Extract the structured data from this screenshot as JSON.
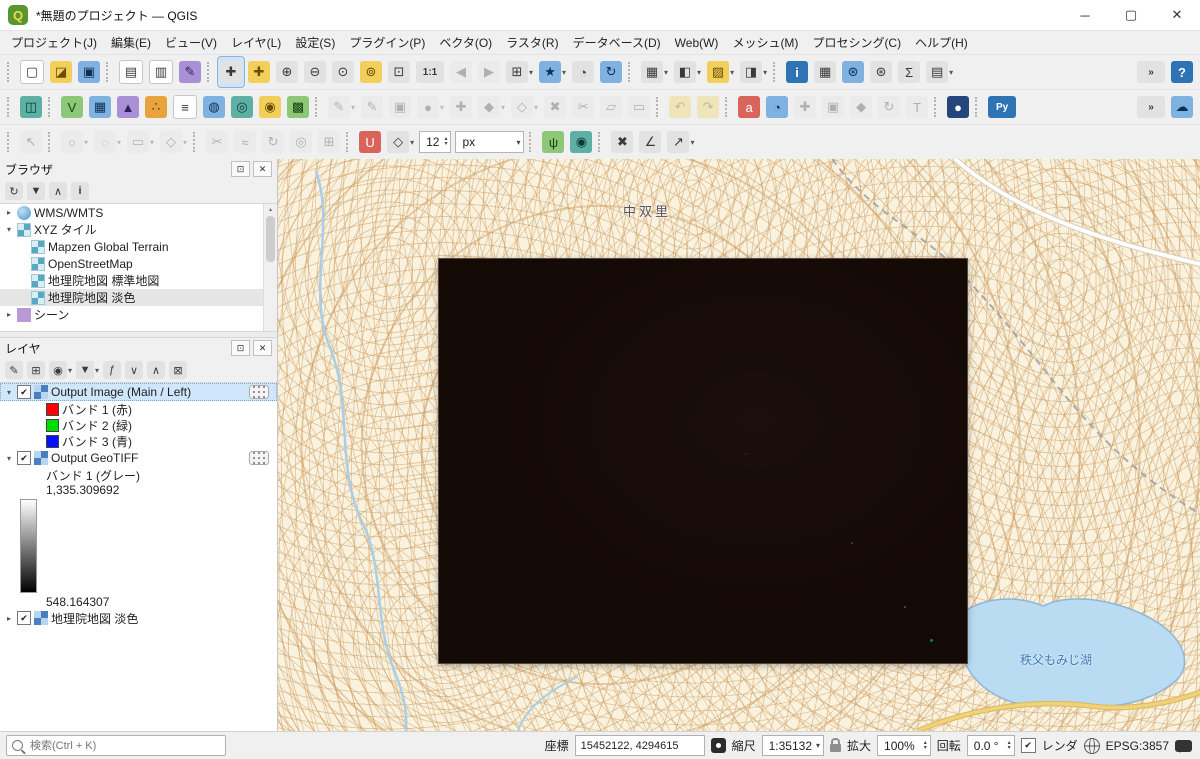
{
  "ui": {
    "dropdown": "▾",
    "overflow": "»",
    "arrow_right": "▸",
    "arrow_down": "▾",
    "check": "✔",
    "float": "⊡",
    "close": "✕",
    "spin_up": "▴",
    "spin_down": "▾",
    "logo": "Q",
    "help": "?"
  },
  "window": {
    "title": "*無題のプロジェクト — QGIS",
    "controls": {
      "minimize": "─",
      "maximize": "▢",
      "close": "✕"
    }
  },
  "menus": [
    {
      "id": "project",
      "label": "プロジェクト(J)"
    },
    {
      "id": "edit",
      "label": "編集(E)"
    },
    {
      "id": "view",
      "label": "ビュー(V)"
    },
    {
      "id": "layer",
      "label": "レイヤ(L)"
    },
    {
      "id": "settings",
      "label": "設定(S)"
    },
    {
      "id": "plugins",
      "label": "プラグイン(P)"
    },
    {
      "id": "vector",
      "label": "ベクタ(O)"
    },
    {
      "id": "raster",
      "label": "ラスタ(R)"
    },
    {
      "id": "database",
      "label": "データベース(D)"
    },
    {
      "id": "web",
      "label": "Web(W)"
    },
    {
      "id": "mesh",
      "label": "メッシュ(M)"
    },
    {
      "id": "processing",
      "label": "プロセシング(C)"
    },
    {
      "id": "help",
      "label": "ヘルプ(H)"
    }
  ],
  "toolbar_rows": [
    {
      "name": "toolbar-row-1",
      "groups": [
        [
          {
            "name": "new-project",
            "glyph": "▢",
            "tint": "white"
          },
          {
            "name": "open-project",
            "glyph": "◪",
            "tint": "yellow"
          },
          {
            "name": "save-project",
            "glyph": "▣",
            "tint": "blue"
          }
        ],
        [
          {
            "name": "new-print-layout",
            "glyph": "▤",
            "tint": "white"
          },
          {
            "name": "layout-manager",
            "glyph": "▥",
            "tint": "white"
          },
          {
            "name": "style-manager",
            "glyph": "✎",
            "tint": "purple"
          }
        ],
        [
          {
            "name": "pan-map",
            "glyph": "✚",
            "active": true
          },
          {
            "name": "pan-to-selection",
            "glyph": "✚",
            "tint": "yellow"
          },
          {
            "name": "zoom-in",
            "glyph": "⊕"
          },
          {
            "name": "zoom-out",
            "glyph": "⊖"
          },
          {
            "name": "zoom-full",
            "glyph": "⊙"
          },
          {
            "name": "zoom-to-selection",
            "glyph": "⊚",
            "tint": "yellow"
          },
          {
            "name": "zoom-to-layer",
            "glyph": "⊡"
          },
          {
            "name": "zoom-native",
            "glyph": "1:1",
            "wide": true
          },
          {
            "name": "zoom-last",
            "glyph": "◀",
            "disabled": true
          },
          {
            "name": "zoom-next",
            "glyph": "▶",
            "disabled": true
          },
          {
            "name": "new-map-view",
            "glyph": "⊞",
            "dropdown": true
          },
          {
            "name": "show-spatial-bookmarks",
            "glyph": "★",
            "tint": "blue",
            "dropdown": true
          },
          {
            "name": "temporal-controller",
            "glyph": "◔"
          },
          {
            "name": "refresh-map",
            "glyph": "↻",
            "tint": "blue"
          }
        ],
        [
          {
            "name": "new-3d-map-view",
            "glyph": "▦",
            "dropdown": true
          },
          {
            "name": "map-decorations",
            "glyph": "◧",
            "dropdown": true
          },
          {
            "name": "copy-layer-style",
            "glyph": "▨",
            "tint": "yellow",
            "dropdown": true
          },
          {
            "name": "project-styles",
            "glyph": "◨",
            "dropdown": true
          }
        ],
        [
          {
            "name": "identify-features",
            "glyph": "i",
            "tint": "blue-solid"
          },
          {
            "name": "open-attribute-table",
            "glyph": "▦"
          },
          {
            "name": "options",
            "glyph": "⊛",
            "tint": "blue"
          },
          {
            "name": "processing-toolbox",
            "glyph": "⊛"
          },
          {
            "name": "statistical-summary",
            "glyph": "Σ"
          },
          {
            "name": "manage-panels",
            "glyph": "▤",
            "dropdown": true
          }
        ]
      ],
      "right": [
        {
          "name": "toolbar-overflow-1",
          "glyph": "»",
          "wide": true
        },
        {
          "name": "help-contents",
          "glyph": "?",
          "tint": "blue-solid"
        }
      ]
    },
    {
      "name": "toolbar-row-2",
      "groups": [
        [
          {
            "name": "data-source-manager",
            "glyph": "◫",
            "tint": "teal"
          }
        ],
        [
          {
            "name": "add-vector-layer",
            "glyph": "V",
            "tint": "green"
          },
          {
            "name": "add-raster-layer",
            "glyph": "▦",
            "tint": "blue"
          },
          {
            "name": "add-mesh-layer",
            "glyph": "▲",
            "tint": "purple"
          },
          {
            "name": "add-point-cloud-layer",
            "glyph": "∴",
            "tint": "orange"
          },
          {
            "name": "add-delimited-text-layer",
            "glyph": "≡",
            "tint": "white"
          },
          {
            "name": "add-postgis-layer",
            "glyph": "◍",
            "tint": "blue"
          },
          {
            "name": "add-spatialite-layer",
            "glyph": "◎",
            "tint": "teal"
          },
          {
            "name": "add-wms-layer",
            "glyph": "◉",
            "tint": "yellow"
          },
          {
            "name": "add-xyz-layer",
            "glyph": "▩",
            "tint": "green"
          }
        ],
        [
          {
            "name": "current-edits",
            "glyph": "✎",
            "disabled": true,
            "dropdown": true
          },
          {
            "name": "toggle-editing",
            "glyph": "✎",
            "disabled": true
          },
          {
            "name": "save-layer-edits",
            "glyph": "▣",
            "disabled": true
          },
          {
            "name": "digitize-with-segment",
            "glyph": "●",
            "disabled": true,
            "dropdown": true
          },
          {
            "name": "add-feature",
            "glyph": "✚",
            "disabled": true
          },
          {
            "name": "move-feature",
            "glyph": "◆",
            "disabled": true,
            "dropdown": true
          },
          {
            "name": "vertex-tool",
            "glyph": "◇",
            "disabled": true,
            "dropdown": true
          },
          {
            "name": "delete-selected",
            "glyph": "✖",
            "disabled": true
          },
          {
            "name": "cut-features",
            "glyph": "✂",
            "disabled": true
          },
          {
            "name": "copy-features",
            "glyph": "▱",
            "disabled": true
          },
          {
            "name": "paste-features",
            "glyph": "▭",
            "disabled": true
          }
        ],
        [
          {
            "name": "undo",
            "glyph": "↶",
            "tint": "yellow",
            "disabled": true
          },
          {
            "name": "redo",
            "glyph": "↷",
            "tint": "yellow",
            "disabled": true
          }
        ],
        [
          {
            "name": "layer-labeling",
            "glyph": "a",
            "tint": "red"
          },
          {
            "name": "layer-diagrams",
            "glyph": "◔",
            "tint": "blue"
          },
          {
            "name": "pin-unpin-labels",
            "glyph": "✚",
            "disabled": true
          },
          {
            "name": "highlight-pinned-labels",
            "glyph": "▣",
            "disabled": true
          },
          {
            "name": "move-label",
            "glyph": "◆",
            "disabled": true
          },
          {
            "name": "rotate-label",
            "glyph": "↻",
            "disabled": true
          },
          {
            "name": "change-label",
            "glyph": "T",
            "disabled": true
          }
        ],
        [
          {
            "name": "metasearch",
            "glyph": "●",
            "tint": "dark-blue"
          }
        ],
        [
          {
            "name": "python-console",
            "glyph": "Py",
            "tint": "blue-solid",
            "wide": true
          }
        ]
      ],
      "right": [
        {
          "name": "toolbar-overflow-2",
          "glyph": "»",
          "wide": true
        },
        {
          "name": "cloud-projects",
          "glyph": "☁",
          "tint": "blue"
        }
      ]
    },
    {
      "name": "toolbar-row-3",
      "groups": [
        [
          {
            "name": "select-features-tool",
            "glyph": "↖",
            "disabled": true
          }
        ],
        [
          {
            "name": "digitize-circle",
            "glyph": "○",
            "disabled": true,
            "dropdown": true
          },
          {
            "name": "digitize-ellipse",
            "glyph": "◌",
            "disabled": true,
            "dropdown": true
          },
          {
            "name": "digitize-rectangle",
            "glyph": "▭",
            "disabled": true,
            "dropdown": true
          },
          {
            "name": "digitize-regular-polygon",
            "glyph": "◇",
            "disabled": true,
            "dropdown": true
          }
        ],
        [
          {
            "name": "split-features",
            "glyph": "✂",
            "disabled": true
          },
          {
            "name": "reshape-features",
            "glyph": "≈",
            "disabled": true
          },
          {
            "name": "rotate-feature",
            "glyph": "↻",
            "disabled": true
          },
          {
            "name": "offset-curve",
            "glyph": "◎",
            "disabled": true
          },
          {
            "name": "merge-features",
            "glyph": "⊞",
            "disabled": true
          }
        ],
        [
          {
            "name": "enable-snapping",
            "glyph": "U",
            "tint": "red"
          },
          {
            "name": "snapping-mode",
            "glyph": "◇",
            "dropdown": true
          },
          {
            "name": "snapping-tolerance",
            "type": "spin",
            "value": "12"
          },
          {
            "name": "snapping-unit",
            "type": "select",
            "value": "px"
          }
        ],
        [
          {
            "name": "enable-tracing",
            "glyph": "ψ",
            "tint": "green"
          },
          {
            "name": "advanced-digitizing",
            "glyph": "◉",
            "tint": "teal"
          }
        ],
        [
          {
            "name": "clear-canvas",
            "glyph": "✖"
          },
          {
            "name": "azimuth-tool",
            "glyph": "∠"
          },
          {
            "name": "pointer-tool",
            "glyph": "↗",
            "dropdown": true
          }
        ]
      ],
      "right": []
    }
  ],
  "browser": {
    "title": "ブラウザ",
    "toolbar": [
      {
        "name": "browser-refresh",
        "glyph": "↻"
      },
      {
        "name": "browser-filter",
        "glyph": "▼",
        "tint": "yellow"
      },
      {
        "name": "browser-collapse-all",
        "glyph": "∧"
      },
      {
        "name": "browser-properties",
        "glyph": "i",
        "tint": "blue-solid"
      }
    ],
    "items": [
      {
        "label": "WMS/WMTS",
        "depth": 0,
        "arrow": "right",
        "icon": "wms"
      },
      {
        "label": "XYZ タイル",
        "depth": 0,
        "arrow": "down",
        "icon": "grid"
      },
      {
        "label": "Mapzen Global Terrain",
        "depth": 1,
        "icon": "grid"
      },
      {
        "label": "OpenStreetMap",
        "depth": 1,
        "icon": "grid"
      },
      {
        "label": "地理院地図 標準地図",
        "depth": 1,
        "icon": "grid"
      },
      {
        "label": "地理院地図 淡色",
        "depth": 1,
        "icon": "grid",
        "selected": true
      },
      {
        "label": "シーン",
        "depth": 0,
        "arrow": "right",
        "icon": "scene"
      }
    ]
  },
  "layers": {
    "title": "レイヤ",
    "toolbar": [
      {
        "name": "open-layer-styling",
        "glyph": "✎"
      },
      {
        "name": "add-group",
        "glyph": "⊞"
      },
      {
        "name": "manage-map-themes",
        "glyph": "◉",
        "dropdown": true
      },
      {
        "name": "filter-legend",
        "glyph": "▼",
        "tint": "yellow",
        "dropdown": true
      },
      {
        "name": "filter-by-expression",
        "glyph": "ƒ"
      },
      {
        "name": "expand-all",
        "glyph": "∨"
      },
      {
        "name": "collapse-all",
        "glyph": "∧"
      },
      {
        "name": "remove-layer",
        "glyph": "⊠"
      }
    ],
    "items": [
      {
        "type": "layer",
        "arrow": "down",
        "checked": true,
        "label": "Output Image (Main / Left)",
        "selected": true,
        "badge": true
      },
      {
        "type": "band",
        "color": "#ff0000",
        "label": "バンド 1 (赤)"
      },
      {
        "type": "band",
        "color": "#00dd00",
        "label": "バンド 2 (緑)"
      },
      {
        "type": "band",
        "color": "#0011ff",
        "label": "バンド 3 (青)"
      },
      {
        "type": "layer",
        "arrow": "down",
        "checked": true,
        "label": "Output GeoTIFF",
        "badge": true
      },
      {
        "type": "text",
        "label": "バンド 1 (グレー)"
      },
      {
        "type": "gradient",
        "top": "1,335.309692",
        "bottom": "548.164307"
      },
      {
        "type": "layer",
        "arrow": "right",
        "checked": true,
        "label": "地理院地図 淡色"
      }
    ]
  },
  "map": {
    "labels": [
      {
        "id": "place",
        "text": "中双里"
      },
      {
        "id": "lake",
        "text": "秩父もみじ湖"
      }
    ]
  },
  "statusbar": {
    "locator_placeholder": "検索(Ctrl + K)",
    "coord_label": "座標",
    "coord_value": "15452122, 4294615",
    "scale_label": "縮尺",
    "scale_value": "1:35132",
    "magnifier_label": "拡大",
    "magnifier_value": "100%",
    "rotation_label": "回転",
    "rotation_value": "0.0 °",
    "render_label": "レンダ",
    "crs": "EPSG:3857"
  }
}
